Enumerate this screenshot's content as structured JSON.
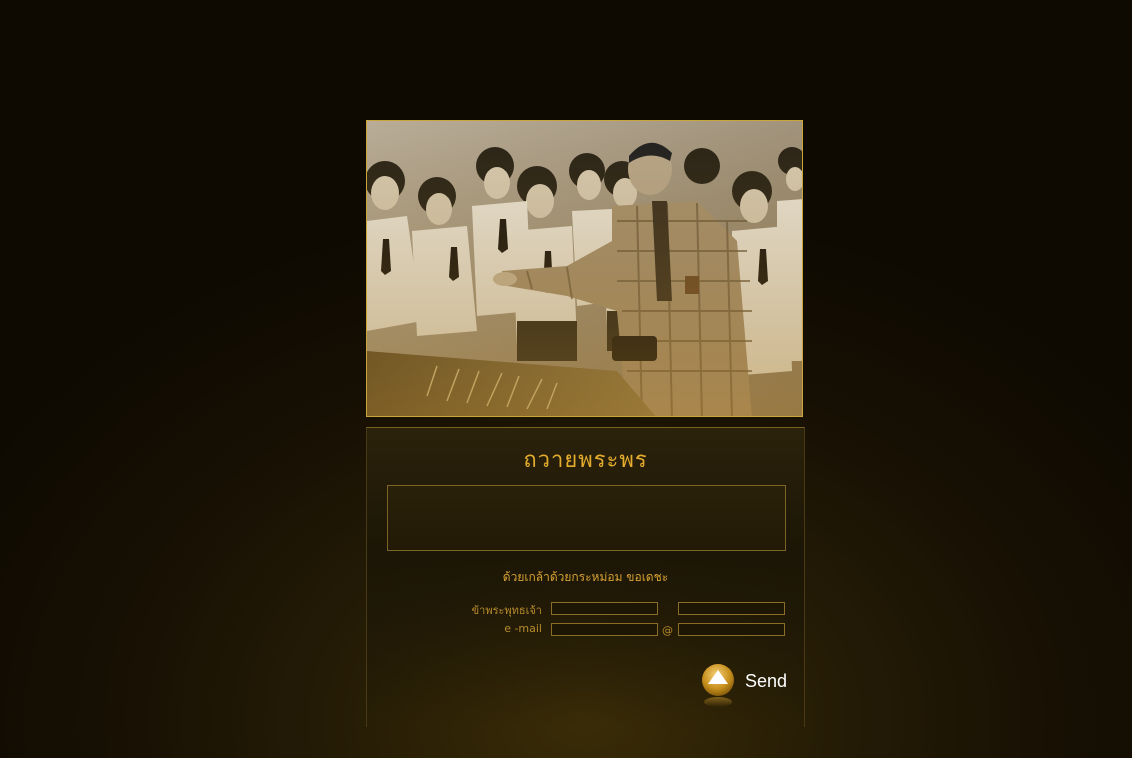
{
  "photo": {
    "description_icon": "photo-icon"
  },
  "form": {
    "title": "ถวายพระพร",
    "message_value": "",
    "blessing_line": "ด้วยเกล้าด้วยกระหม่อม ขอเดชะ",
    "name_label": "ข้าพระพุทธเจ้า",
    "first_name_value": "",
    "last_name_value": "",
    "email_label": "e -mail",
    "email_user_value": "",
    "at_symbol": "@",
    "email_domain_value": "",
    "send_label": "Send",
    "send_icon": "up-arrow-icon"
  },
  "colors": {
    "accent": "#e4ac2c",
    "border": "#c9a53a",
    "background": "#160f03"
  }
}
